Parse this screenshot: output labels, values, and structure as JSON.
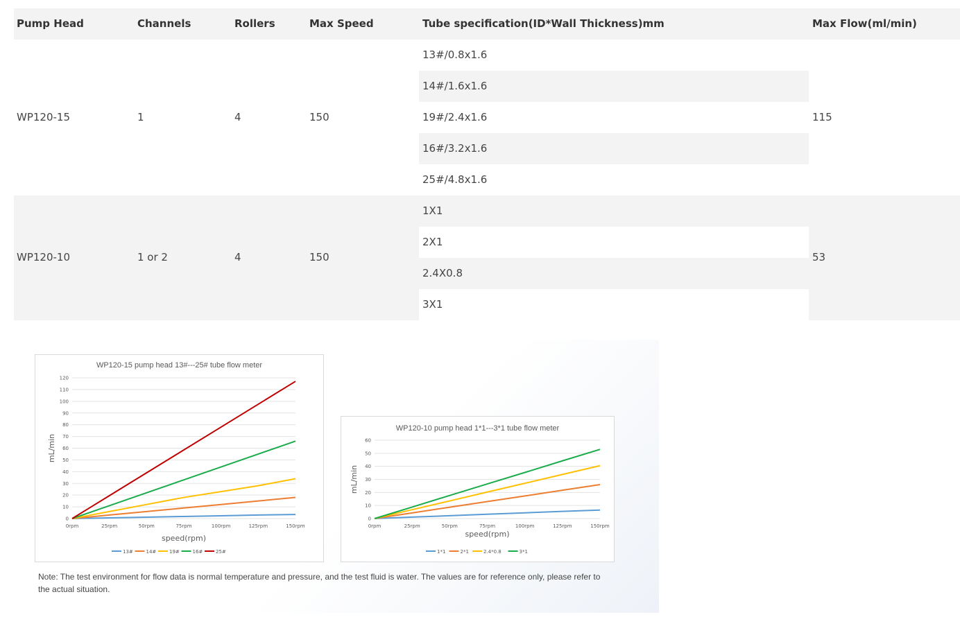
{
  "table": {
    "headers": [
      "Pump Head",
      "Channels",
      "Rollers",
      "Max Speed",
      "Tube specification(ID*Wall Thickness)mm",
      "Max Flow(ml/min)"
    ],
    "groups": [
      {
        "pump_head": "WP120-15",
        "channels": "1",
        "rollers": "4",
        "max_speed": "150",
        "tubes": [
          "13#/0.8x1.6",
          "14#/1.6x1.6",
          "19#/2.4x1.6",
          "16#/3.2x1.6",
          "25#/4.8x1.6"
        ],
        "max_flow": "115"
      },
      {
        "pump_head": "WP120-10",
        "channels": "1 or 2",
        "rollers": "4",
        "max_speed": "150",
        "tubes": [
          "1X1",
          "2X1",
          "2.4X0.8",
          "3X1"
        ],
        "max_flow": "53"
      }
    ]
  },
  "chart_data": [
    {
      "type": "line",
      "title": "WP120-15 pump head 13#---25# tube flow meter",
      "xlabel": "speed(rpm)",
      "ylabel": "mL/min",
      "categories": [
        "0rpm",
        "25rpm",
        "50rpm",
        "75rpm",
        "100rpm",
        "125rpm",
        "150rpm"
      ],
      "ylim": [
        0,
        120
      ],
      "yticks": [
        0,
        10,
        20,
        30,
        40,
        50,
        60,
        70,
        80,
        90,
        100,
        110,
        120
      ],
      "legend": "bottom",
      "grid": true,
      "series": [
        {
          "name": "13#",
          "color": "#5b9bd5",
          "values": [
            0,
            0.6,
            1.2,
            1.8,
            2.4,
            3,
            3.5
          ]
        },
        {
          "name": "14#",
          "color": "#ed7d31",
          "values": [
            0,
            3,
            6,
            9,
            12,
            15,
            18
          ]
        },
        {
          "name": "19#",
          "color": "#ffc000",
          "values": [
            0,
            6,
            12,
            18,
            23,
            28,
            34
          ]
        },
        {
          "name": "16#",
          "color": "#1aab4b",
          "values": [
            0,
            11,
            22,
            33,
            44,
            55,
            66
          ]
        },
        {
          "name": "25#",
          "color": "#c00000",
          "values": [
            0,
            19.5,
            39,
            58.5,
            78,
            97.5,
            117
          ]
        }
      ]
    },
    {
      "type": "line",
      "title": "WP120-10 pump head 1*1---3*1 tube flow meter",
      "xlabel": "speed(rpm)",
      "ylabel": "mL/min",
      "categories": [
        "0rpm",
        "25rpm",
        "50rpm",
        "75rpm",
        "100rpm",
        "125rpm",
        "150rpm"
      ],
      "ylim": [
        0,
        60
      ],
      "yticks": [
        0,
        10,
        20,
        30,
        40,
        50,
        60
      ],
      "legend": "bottom",
      "grid": true,
      "series": [
        {
          "name": "1*1",
          "color": "#5b9bd5",
          "values": [
            0,
            1.1,
            2.2,
            3.3,
            4.4,
            5.5,
            6.5
          ]
        },
        {
          "name": "2*1",
          "color": "#ed7d31",
          "values": [
            0,
            4.3,
            8.7,
            13,
            17.3,
            21.7,
            26
          ]
        },
        {
          "name": "2.4*0.8",
          "color": "#ffc000",
          "values": [
            0,
            6.8,
            13.5,
            20.3,
            27,
            33.8,
            40.5
          ]
        },
        {
          "name": "3*1",
          "color": "#1aab4b",
          "values": [
            0,
            8.8,
            17.7,
            26.5,
            35.3,
            44.2,
            53
          ]
        }
      ]
    }
  ],
  "note": "Note: The test environment for flow data is normal temperature and pressure, and the test fluid is water. The values are for reference only, please refer to the actual situation."
}
